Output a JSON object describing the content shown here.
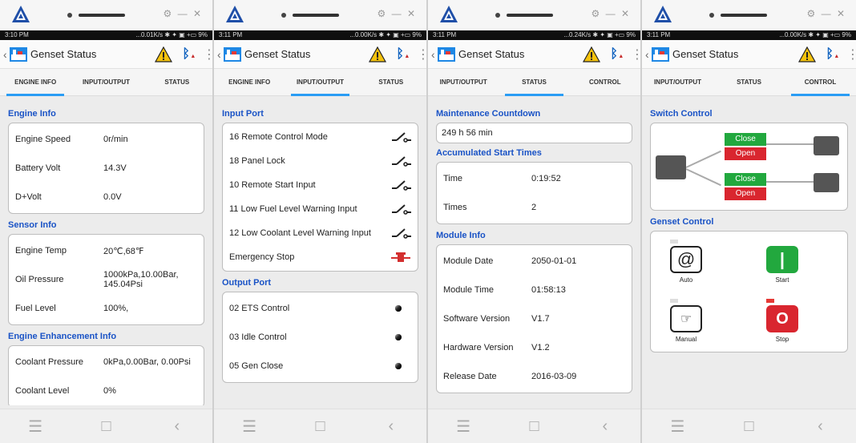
{
  "window": {
    "controls": "⚙ — ✕"
  },
  "phones": [
    {
      "time": "3:10 PM",
      "net": "...0.01K/s ✱ ✦ ▣ +▭ 9%",
      "title": "Genset Status",
      "tabs": [
        "ENGINE INFO",
        "INPUT/OUTPUT",
        "STATUS"
      ],
      "active": 0
    },
    {
      "time": "3:11 PM",
      "net": "...0.00K/s ✱ ✦ ▣ +▭ 9%",
      "title": "Genset Status",
      "tabs": [
        "ENGINE INFO",
        "INPUT/OUTPUT",
        "STATUS"
      ],
      "active": 1
    },
    {
      "time": "3:11 PM",
      "net": "...0.24K/s ✱ ✦ ▣ +▭ 9%",
      "title": "Genset Status",
      "tabs": [
        "INPUT/OUTPUT",
        "STATUS",
        "CONTROL"
      ],
      "active": 1
    },
    {
      "time": "3:11 PM",
      "net": "...0.00K/s ✱ ✦ ▣ +▭ 9%",
      "title": "Genset Status",
      "tabs": [
        "INPUT/OUTPUT",
        "STATUS",
        "CONTROL"
      ],
      "active": 2
    }
  ],
  "engine": {
    "engine_info_title": "Engine Info",
    "engine_info": [
      [
        "Engine Speed",
        "0r/min"
      ],
      [
        "Battery Volt",
        "14.3V"
      ],
      [
        "D+Volt",
        "0.0V"
      ]
    ],
    "sensor_title": "Sensor Info",
    "sensor": [
      [
        "Engine Temp",
        "20℃,68℉"
      ],
      [
        "Oil Pressure",
        "1000kPa,10.00Bar, 145.04Psi"
      ],
      [
        "Fuel Level",
        "100%,"
      ]
    ],
    "enh_title": "Engine Enhancement Info",
    "enh": [
      [
        "Coolant Pressure",
        "0kPa,0.00Bar, 0.00Psi"
      ],
      [
        "Coolant Level",
        "0%"
      ]
    ]
  },
  "io": {
    "input_title": "Input Port",
    "inputs": [
      "16 Remote Control Mode",
      "18 Panel Lock",
      "10 Remote Start Input",
      "11 Low Fuel Level Warning Input",
      "12 Low Coolant Level Warning Input",
      "Emergency Stop"
    ],
    "output_title": "Output Port",
    "outputs": [
      "02 ETS Control",
      "03 Idle Control",
      "05 Gen Close"
    ]
  },
  "status": {
    "maint_title": "Maintenance Countdown",
    "maint_value": "249 h 56 min",
    "acc_title": "Accumulated Start Times",
    "acc": [
      [
        "Time",
        "0:19:52"
      ],
      [
        "Times",
        "2"
      ]
    ],
    "module_title": "Module Info",
    "module": [
      [
        "Module Date",
        "2050-01-01"
      ],
      [
        "Module Time",
        "01:58:13"
      ],
      [
        "Software Version",
        "V1.7"
      ],
      [
        "Hardware Version",
        "V1.2"
      ],
      [
        "Release Date",
        "2016-03-09"
      ]
    ]
  },
  "control": {
    "switch_title": "Switch Control",
    "close_label": "Close",
    "open_label": "Open",
    "genset_title": "Genset Control",
    "auto": "Auto",
    "start": "Start",
    "manual": "Manual",
    "stop": "Stop"
  }
}
